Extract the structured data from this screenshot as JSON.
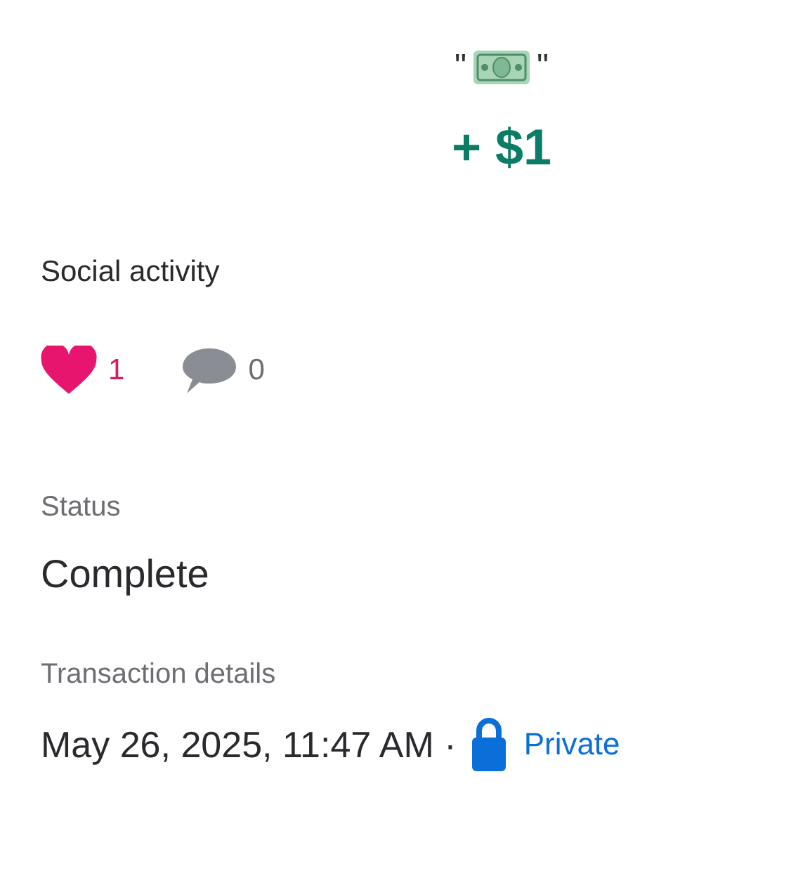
{
  "note": {
    "open_quote": "\"",
    "close_quote": "\""
  },
  "amount": "+ $1",
  "social": {
    "title": "Social activity",
    "likes": "1",
    "liked": true,
    "comments": "0"
  },
  "status": {
    "label": "Status",
    "value": "Complete"
  },
  "details": {
    "label": "Transaction details",
    "date": "May 26, 2025, 11:47 AM ·",
    "privacy": "Private"
  }
}
